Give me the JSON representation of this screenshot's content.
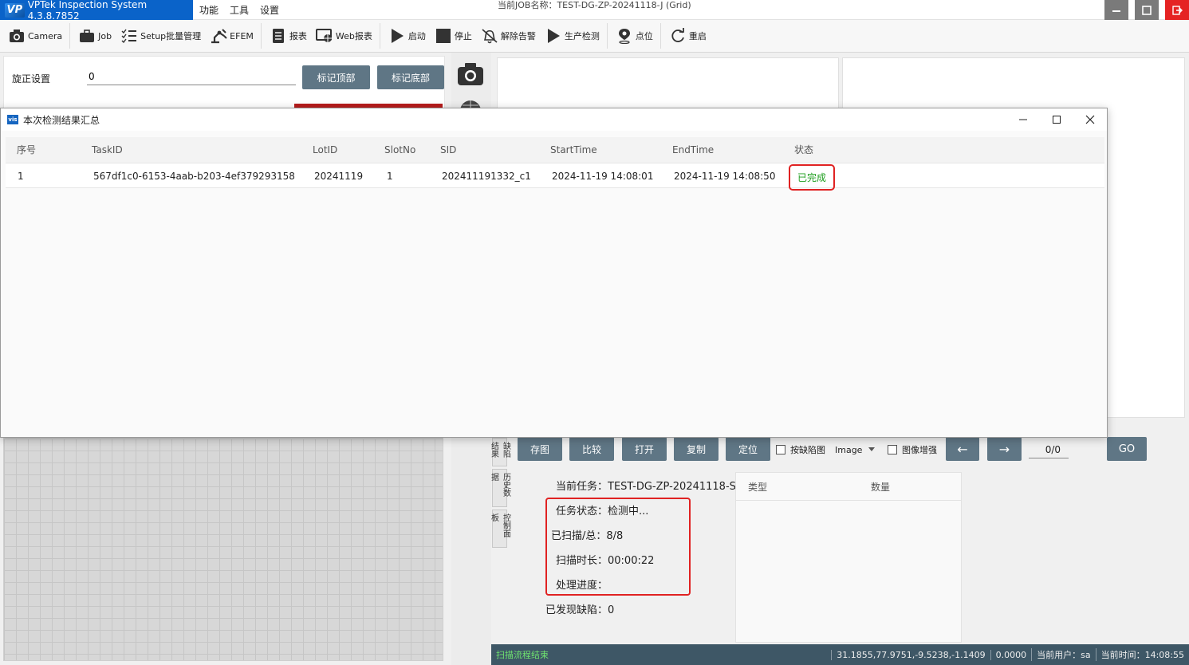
{
  "app": {
    "title": "VPTek Inspection System 4.3.8.7852",
    "logo_text": "VP",
    "menu": [
      "功能",
      "工具",
      "设置"
    ],
    "job_label": "当前JOB名称：TEST-DG-ZP-20241118-J (Grid)"
  },
  "toolbar": {
    "items": [
      {
        "label": "Camera",
        "icon": "camera-icon"
      },
      {
        "label": "Job",
        "icon": "briefcase-icon"
      },
      {
        "label": "Setup批量管理",
        "icon": "checklist-icon"
      },
      {
        "label": "EFEM",
        "icon": "robot-arm-icon"
      },
      {
        "label": "报表",
        "icon": "report-icon"
      },
      {
        "label": "Web报表",
        "icon": "web-report-icon"
      },
      {
        "label": "启动",
        "icon": "play-icon"
      },
      {
        "label": "停止",
        "icon": "stop-icon"
      },
      {
        "label": "解除告警",
        "icon": "bell-off-icon"
      },
      {
        "label": "生产检测",
        "icon": "play-icon"
      },
      {
        "label": "点位",
        "icon": "location-pin-icon"
      },
      {
        "label": "重启",
        "icon": "refresh-icon"
      }
    ]
  },
  "settings": {
    "rotation_label": "旋正设置",
    "rotation_value": "0",
    "mark_top": "标记顶部",
    "mark_bottom": "标记底部"
  },
  "dialog": {
    "title": "本次检测结果汇总",
    "icon_text": "vis",
    "columns": [
      "序号",
      "TaskID",
      "LotID",
      "SlotNo",
      "SID",
      "StartTime",
      "EndTime",
      "状态"
    ],
    "rows": [
      {
        "index": "1",
        "task_id": "567df1c0-6153-4aab-b203-4ef379293158",
        "lot_id": "20241119",
        "slot_no": "1",
        "sid": "202411191332_c1",
        "start_time": "2024-11-19 14:08:01",
        "end_time": "2024-11-19 14:08:50",
        "status": "已完成"
      }
    ]
  },
  "side_tabs": [
    "缺陷结果",
    "历史数据",
    "控制面板"
  ],
  "image_toolbar": {
    "save": "存图",
    "compare": "比较",
    "open": "打开",
    "copy": "复制",
    "locate": "定位",
    "by_defect_label": "按缺陷图",
    "image_select": "Image",
    "enhance_label": "图像增强",
    "prev": "←",
    "next": "→",
    "page": "0/0",
    "go": "GO"
  },
  "task_info": {
    "current_task": "当前任务：TEST-DG-ZP-20241118-S",
    "task_status": "任务状态：检测中...",
    "scanned": "已扫描/总：8/8",
    "scan_duration": "扫描时长：00:00:22",
    "progress": "处理进度：",
    "defects_found": "已发现缺陷：0"
  },
  "defect_table": {
    "columns": [
      "类型",
      "数量"
    ]
  },
  "statusbar": {
    "message": "扫描流程结束",
    "coords": "31.1855,77.9751,-9.5238,-1.1409",
    "value": "0.0000",
    "user": "当前用户：sa",
    "time": "当前时间：14:08:55"
  },
  "colors": {
    "brand": "#0a63c9",
    "button": "#5f7685",
    "highlight": "#e02222",
    "status_done": "#1e9e1e",
    "statusbar": "#3e5766"
  }
}
